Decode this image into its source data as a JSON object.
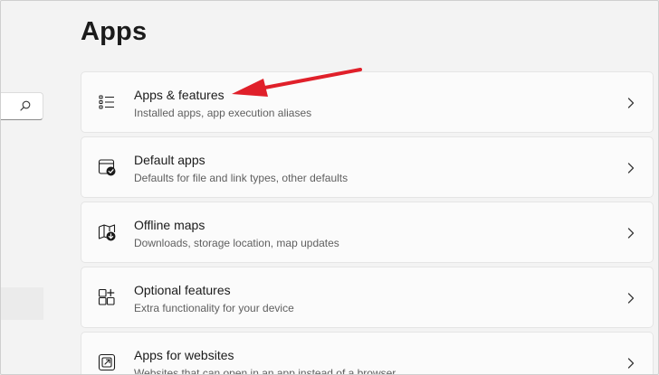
{
  "page": {
    "title": "Apps"
  },
  "search": {
    "icon": "search-icon"
  },
  "cards": [
    {
      "title": "Apps & features",
      "description": "Installed apps, app execution aliases",
      "icon": "apps-features-list-icon"
    },
    {
      "title": "Default apps",
      "description": "Defaults for file and link types, other defaults",
      "icon": "default-apps-icon"
    },
    {
      "title": "Offline maps",
      "description": "Downloads, storage location, map updates",
      "icon": "offline-maps-icon"
    },
    {
      "title": "Optional features",
      "description": "Extra functionality for your device",
      "icon": "optional-features-icon"
    },
    {
      "title": "Apps for websites",
      "description": "Websites that can open in an app instead of a browser",
      "icon": "apps-for-websites-icon"
    }
  ],
  "annotation": {
    "arrow_color": "#e0202a",
    "target": "Apps & features"
  }
}
